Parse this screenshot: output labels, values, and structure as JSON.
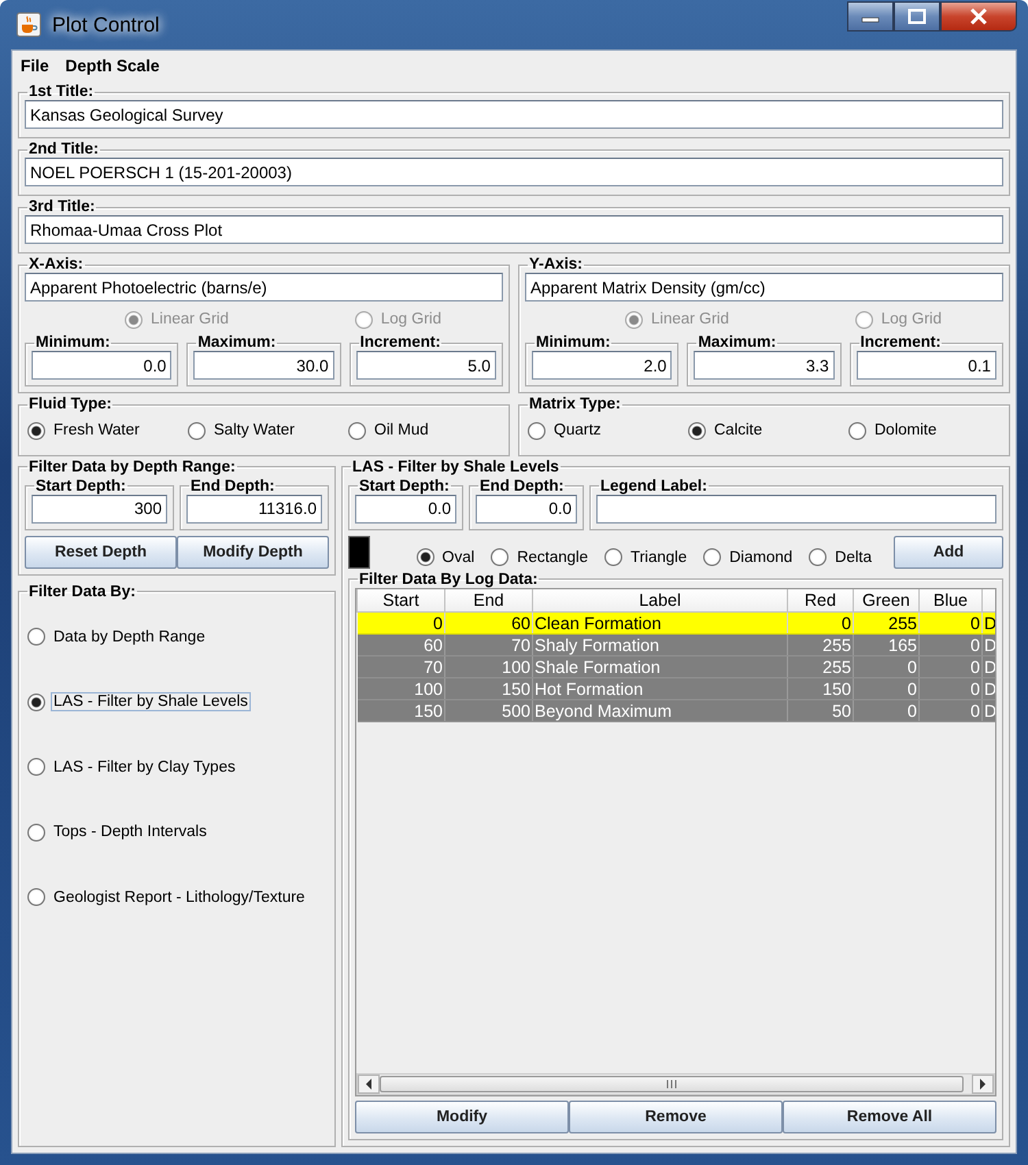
{
  "window": {
    "title": "Plot Control"
  },
  "menu": [
    "File",
    "Depth Scale"
  ],
  "titles": [
    {
      "label": "1st Title:",
      "value": "Kansas Geological Survey"
    },
    {
      "label": "2nd Title:",
      "value": "NOEL POERSCH 1 (15-201-20003)"
    },
    {
      "label": "3rd Title:",
      "value": "Rhomaa-Umaa Cross Plot"
    }
  ],
  "axes": [
    {
      "label": "X-Axis:",
      "value": "Apparent Photoelectric (barns/e)",
      "grid_disabled": true,
      "grids": [
        {
          "label": "Linear Grid",
          "selected": true
        },
        {
          "label": "Log Grid",
          "selected": false
        }
      ],
      "fields": [
        {
          "label": "Minimum:",
          "value": "0.0"
        },
        {
          "label": "Maximum:",
          "value": "30.0"
        },
        {
          "label": "Increment:",
          "value": "5.0"
        }
      ]
    },
    {
      "label": "Y-Axis:",
      "value": "Apparent Matrix Density (gm/cc)",
      "grid_disabled": true,
      "grids": [
        {
          "label": "Linear Grid",
          "selected": true
        },
        {
          "label": "Log Grid",
          "selected": false
        }
      ],
      "fields": [
        {
          "label": "Minimum:",
          "value": "2.0"
        },
        {
          "label": "Maximum:",
          "value": "3.3"
        },
        {
          "label": "Increment:",
          "value": "0.1"
        }
      ]
    }
  ],
  "types": [
    {
      "label": "Fluid Type:",
      "options": [
        {
          "label": "Fresh Water",
          "selected": true
        },
        {
          "label": "Salty Water",
          "selected": false
        },
        {
          "label": "Oil Mud",
          "selected": false
        }
      ]
    },
    {
      "label": "Matrix Type:",
      "options": [
        {
          "label": "Quartz",
          "selected": false
        },
        {
          "label": "Calcite",
          "selected": true
        },
        {
          "label": "Dolomite",
          "selected": false
        }
      ]
    }
  ],
  "depth_range": {
    "label": "Filter Data by Depth Range:",
    "fields": [
      {
        "label": "Start Depth:",
        "value": "300"
      },
      {
        "label": "End Depth:",
        "value": "11316.0"
      }
    ],
    "buttons": [
      "Reset Depth",
      "Modify Depth"
    ]
  },
  "filter_by": {
    "label": "Filter Data By:",
    "options": [
      {
        "label": "Data by Depth Range",
        "selected": false
      },
      {
        "label": "LAS - Filter by Shale Levels",
        "selected": true
      },
      {
        "label": "LAS - Filter by Clay Types",
        "selected": false
      },
      {
        "label": "Tops - Depth Intervals",
        "selected": false
      },
      {
        "label": "Geologist Report - Lithology/Texture",
        "selected": false
      }
    ]
  },
  "las": {
    "label": "LAS - Filter by Shale Levels",
    "fields": [
      {
        "label": "Start Depth:",
        "value": "0.0"
      },
      {
        "label": "End Depth:",
        "value": "0.0"
      }
    ],
    "legend_label": "Legend Label:",
    "shapes": [
      {
        "label": "Oval",
        "selected": true
      },
      {
        "label": "Rectangle",
        "selected": false
      },
      {
        "label": "Triangle",
        "selected": false
      },
      {
        "label": "Diamond",
        "selected": false
      },
      {
        "label": "Delta",
        "selected": false
      }
    ],
    "add_button": "Add",
    "table": {
      "label": "Filter Data By Log Data:",
      "columns": [
        "Start",
        "End",
        "Label",
        "Red",
        "Green",
        "Blue"
      ],
      "rows": [
        {
          "cells": [
            "0",
            "60",
            "Clean Formation",
            "0",
            "255",
            "0",
            "D"
          ],
          "selected": true
        },
        {
          "cells": [
            "60",
            "70",
            "Shaly Formation",
            "255",
            "165",
            "0",
            "D"
          ],
          "selected": false
        },
        {
          "cells": [
            "70",
            "100",
            "Shale Formation",
            "255",
            "0",
            "0",
            "D"
          ],
          "selected": false
        },
        {
          "cells": [
            "100",
            "150",
            "Hot Formation",
            "150",
            "0",
            "0",
            "D"
          ],
          "selected": false
        },
        {
          "cells": [
            "150",
            "500",
            "Beyond Maximum",
            "50",
            "0",
            "0",
            "D"
          ],
          "selected": false
        }
      ]
    },
    "buttons": [
      "Modify",
      "Remove",
      "Remove All"
    ]
  }
}
